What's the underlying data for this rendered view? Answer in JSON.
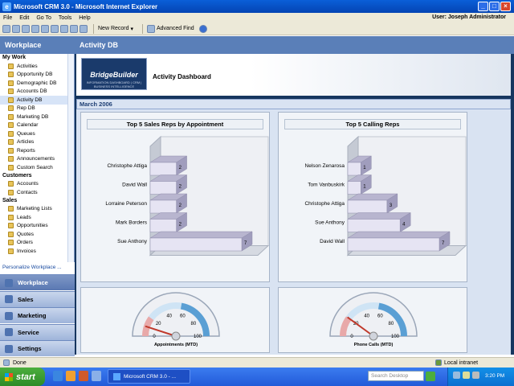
{
  "window": {
    "title": "Microsoft CRM 3.0 - Microsoft Internet Explorer",
    "minimize": "_",
    "maximize": "□",
    "close": "×"
  },
  "menu": {
    "items": [
      "File",
      "Edit",
      "Go To",
      "Tools",
      "Help"
    ],
    "user": "User: Joseph Administrator"
  },
  "toolbar": {
    "new_record": "New Record",
    "advanced_find": "Advanced Find"
  },
  "workplace": {
    "header": "Workplace",
    "page_title": "Activity DB"
  },
  "sidebar": {
    "sections": [
      {
        "label": "My Work",
        "items": [
          "Activities",
          "Opportunity DB",
          "Demographic DB",
          "Accounts DB",
          "Activity DB",
          "Rep DB",
          "Marketing DB",
          "Calendar",
          "Queues",
          "Articles",
          "Reports",
          "Announcements",
          "Custom Search"
        ]
      },
      {
        "label": "Customers",
        "items": [
          "Accounts",
          "Contacts"
        ]
      },
      {
        "label": "Sales",
        "items": [
          "Marketing Lists",
          "Leads",
          "Opportunities",
          "Quotes",
          "Orders",
          "Invoices"
        ]
      }
    ],
    "selected": "Activity DB",
    "personalize": "Personalize Workplace ..."
  },
  "nav": {
    "items": [
      "Workplace",
      "Sales",
      "Marketing",
      "Service",
      "Settings"
    ],
    "active": "Workplace"
  },
  "dashboard": {
    "logo": "BridgeBuilder",
    "logo_tagline": "INFORMATION DASHBOARD | CRM | BUSINESS INTELLIGENCE",
    "title": "Activity Dashboard",
    "month": "March 2006"
  },
  "chart_data": [
    {
      "type": "bar",
      "title": "Top 5 Sales Reps by Appointment",
      "categories": [
        "Christophe Attiga",
        "David Wall",
        "Lorraine Peterson",
        "Mark Borders",
        "Sue Anthony"
      ],
      "values": [
        2,
        2,
        2,
        2,
        7
      ],
      "xlim": [
        0,
        7
      ]
    },
    {
      "type": "bar",
      "title": "Top 5 Calling Reps",
      "categories": [
        "Nelson Zenarosa",
        "Tom Vanbuskirk",
        "Christophe Attiga",
        "Sue Anthony",
        "David Wall"
      ],
      "values": [
        1,
        1,
        3,
        4,
        7
      ],
      "xlim": [
        0,
        7
      ]
    }
  ],
  "gauges": [
    {
      "label": "Appointments (MTD)",
      "ticks": [
        "0",
        "20",
        "40",
        "60",
        "80",
        "100"
      ],
      "value": 10
    },
    {
      "label": "Phone Calls (MTD)",
      "ticks": [
        "0",
        "20",
        "40",
        "60",
        "80",
        "100"
      ],
      "value": 20
    }
  ],
  "status": {
    "left": "Done",
    "zone": "Local intranet"
  },
  "taskbar": {
    "start": "start",
    "task": "Microsoft CRM 3.0 - ...",
    "search_placeholder": "Search Desktop",
    "time": "3:20 PM"
  }
}
